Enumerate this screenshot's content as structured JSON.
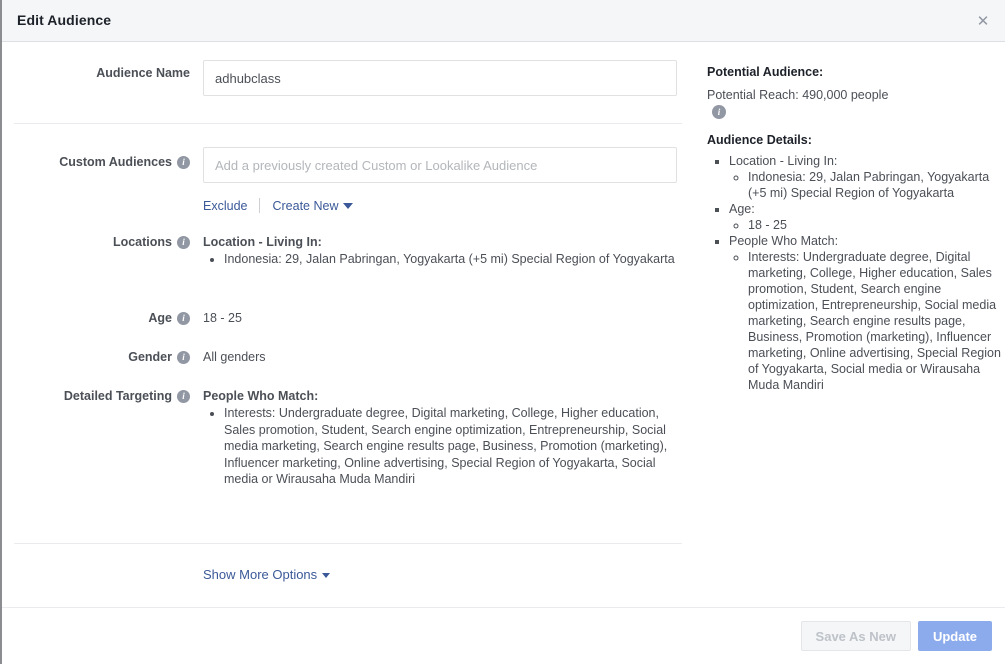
{
  "header": {
    "title": "Edit Audience",
    "close_icon": "close-icon"
  },
  "form": {
    "audience_name": {
      "label": "Audience Name",
      "value": "adhubclass"
    },
    "custom_audiences": {
      "label": "Custom Audiences",
      "placeholder": "Add a previously created Custom or Lookalike Audience",
      "value": "",
      "exclude_link": "Exclude",
      "create_new_link": "Create New"
    },
    "locations": {
      "label": "Locations",
      "heading": "Location - Living In:",
      "items": [
        "Indonesia: 29, Jalan Pabringan, Yogyakarta (+5 mi) Special Region of Yogyakarta"
      ]
    },
    "age": {
      "label": "Age",
      "value": "18 - 25"
    },
    "gender": {
      "label": "Gender",
      "value": "All genders"
    },
    "detailed_targeting": {
      "label": "Detailed Targeting",
      "heading": "People Who Match:",
      "items": [
        "Interests: Undergraduate degree, Digital marketing, College, Higher education, Sales promotion, Student, Search engine optimization, Entrepreneurship, Social media marketing, Search engine results page, Business, Promotion (marketing), Influencer marketing, Online advertising, Special Region of Yogyakarta, Social media or Wirausaha Muda Mandiri"
      ]
    },
    "show_more_options": "Show More Options"
  },
  "summary": {
    "potential_audience_title": "Potential Audience:",
    "potential_reach": "Potential Reach: 490,000 people",
    "reach_info_icon": "info-icon",
    "audience_details_title": "Audience Details:",
    "details": [
      {
        "label": "Location - Living In:",
        "sub": [
          "Indonesia: 29, Jalan Pabringan, Yogyakarta (+5 mi) Special Region of Yogyakarta"
        ]
      },
      {
        "label": "Age:",
        "sub": [
          "18 - 25"
        ]
      },
      {
        "label": "People Who Match:",
        "sub": [
          "Interests: Undergraduate degree, Digital marketing, College, Higher education, Sales promotion, Student, Search engine optimization, Entrepreneurship, Social media marketing, Search engine results page, Business, Promotion (marketing), Influencer marketing, Online advertising, Special Region of Yogyakarta, Social media or Wirausaha Muda Mandiri"
        ]
      }
    ]
  },
  "footer": {
    "save_as_new": "Save As New",
    "update": "Update"
  },
  "colors": {
    "link": "#3b5998",
    "primary_button": "#8cabec",
    "header_bg": "#f5f6f7",
    "label_text": "#4b4f56"
  }
}
